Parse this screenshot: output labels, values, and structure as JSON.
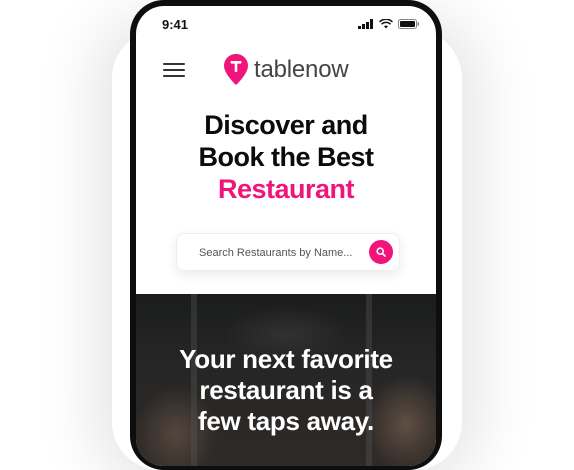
{
  "status": {
    "time": "9:41",
    "icons": [
      "signal-icon",
      "wifi-icon",
      "battery-icon"
    ]
  },
  "header": {
    "menu_icon": "hamburger-menu-icon",
    "logo_icon": "location-pin-icon",
    "logo_text_primary": "table",
    "logo_text_secondary": "now"
  },
  "headline": {
    "line1": "Discover and",
    "line2": "Book the Best",
    "accent_line": "Restaurant"
  },
  "search": {
    "placeholder": "Search Restaurants by Name...",
    "value": "",
    "button_icon": "search-icon"
  },
  "hero": {
    "line1": "Your next favorite",
    "line2": "restaurant is a",
    "line3": "few taps away."
  },
  "colors": {
    "accent": "#ef157a",
    "text_dark": "#0b0b0b",
    "phone_frame": "#0e0e0e"
  }
}
